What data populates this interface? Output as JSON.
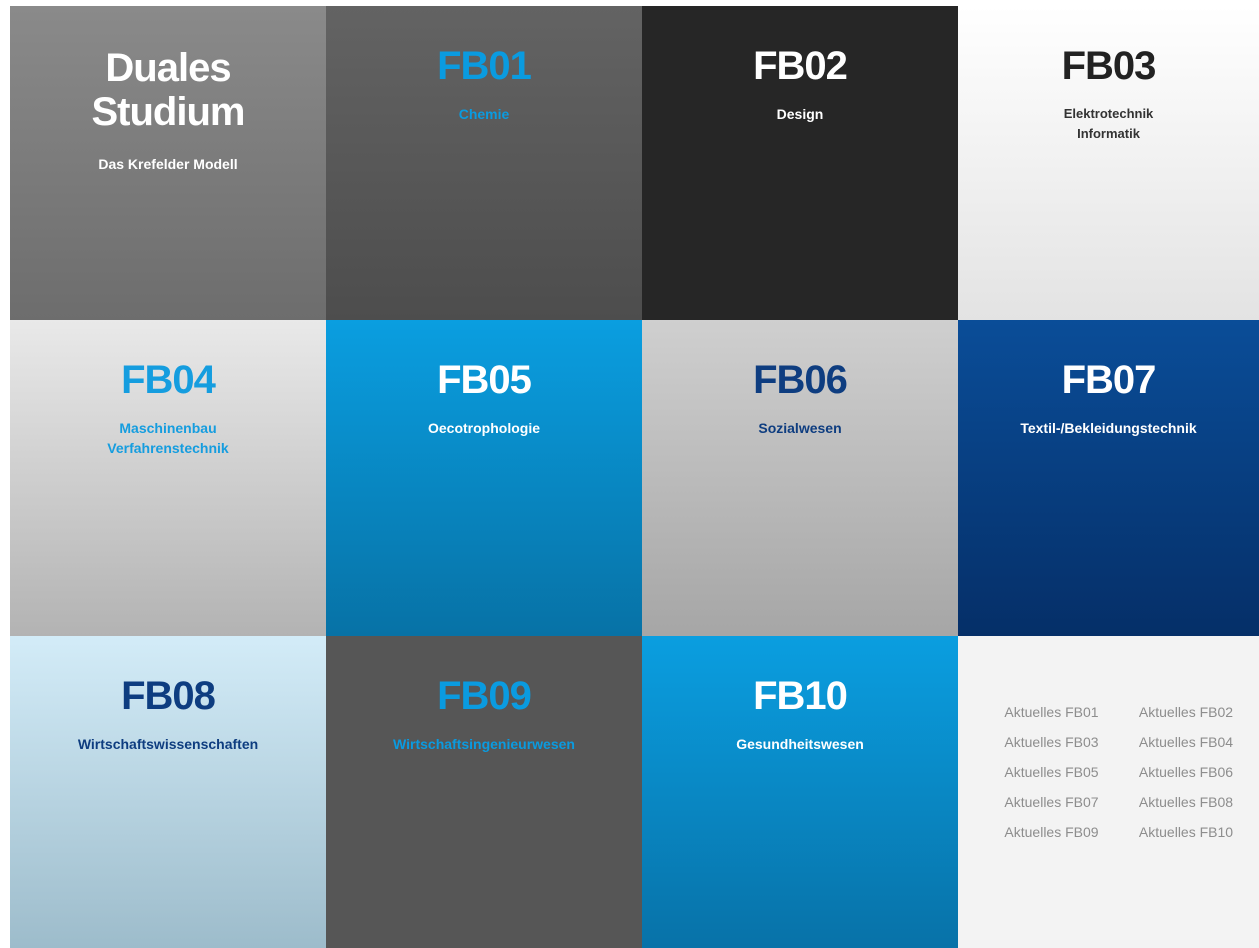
{
  "intro": {
    "title_line1": "Duales",
    "title_line2": "Studium",
    "subtitle": "Das Krefelder Modell"
  },
  "tiles": [
    {
      "code": "FB01",
      "lines": [
        "Chemie"
      ]
    },
    {
      "code": "FB02",
      "lines": [
        "Design"
      ]
    },
    {
      "code": "FB03",
      "lines": [
        "Elektrotechnik",
        "Informatik"
      ]
    },
    {
      "code": "FB04",
      "lines": [
        "Maschinenbau",
        "Verfahrenstechnik"
      ]
    },
    {
      "code": "FB05",
      "lines": [
        "Oecotrophologie"
      ]
    },
    {
      "code": "FB06",
      "lines": [
        "Sozialwesen"
      ]
    },
    {
      "code": "FB07",
      "lines": [
        "Textil-/Bekleidungstechnik"
      ]
    },
    {
      "code": "FB08",
      "lines": [
        "Wirtschaftswissenschaften"
      ]
    },
    {
      "code": "FB09",
      "lines": [
        "Wirtschaftsingenieurwesen"
      ]
    },
    {
      "code": "FB10",
      "lines": [
        "Gesundheitswesen"
      ]
    }
  ],
  "news": [
    "Aktuelles FB01",
    "Aktuelles FB02",
    "Aktuelles FB03",
    "Aktuelles FB04",
    "Aktuelles FB05",
    "Aktuelles FB06",
    "Aktuelles FB07",
    "Aktuelles FB08",
    "Aktuelles FB09",
    "Aktuelles FB10"
  ]
}
